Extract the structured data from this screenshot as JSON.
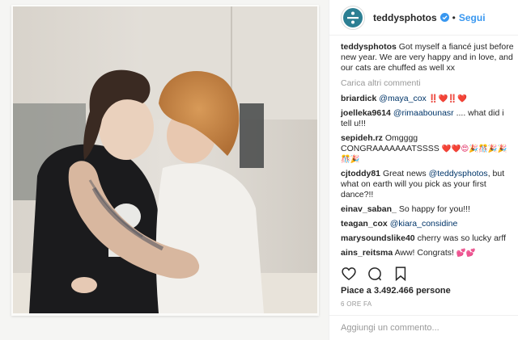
{
  "post": {
    "username": "teddysphotos",
    "separator": "•",
    "follow_label": "Segui",
    "caption_user": "teddysphotos",
    "caption_text": "Got myself a fiancé just before new year. We are very happy and in love, and our cats are chuffed as well xx",
    "load_more": "Carica altri commenti",
    "comments": [
      {
        "user": "briardick",
        "mention": "@maya_cox",
        "text": "",
        "emoji": "‼️❤️‼️❤️"
      },
      {
        "user": "joelleka9614",
        "mention": "@rimaabounasr",
        "text": ".... what did i tell u!!!",
        "emoji": ""
      },
      {
        "user": "sepideh.rz",
        "mention": "",
        "text": "Omgggg CONGRAAAAAAATSSSS",
        "emoji": "❤️❤️😍🎉🎊🎉🎉🎊🎉"
      },
      {
        "user": "cjtoddy81",
        "mention": "",
        "text": "Great news",
        "mention2": "@teddysphotos",
        "text2": ", but what on earth will you pick as your first dance?!!",
        "emoji": ""
      },
      {
        "user": "einav_saban_",
        "mention": "",
        "text": "So happy for you!!!",
        "emoji": ""
      },
      {
        "user": "teagan_cox",
        "mention": "@kiara_considine",
        "text": "",
        "emoji": ""
      },
      {
        "user": "marysoundslike40",
        "mention": "",
        "text": "cherry was so lucky arff",
        "emoji": ""
      },
      {
        "user": "ains_reitsma",
        "mention": "",
        "text": "Aww! Congrats!",
        "emoji": "💕💕"
      }
    ],
    "likes": "Piace a 3.492.466 persone",
    "timestamp": "6 ORE FA",
    "add_comment_placeholder": "Aggiungi un commento..."
  },
  "icons": {
    "avatar": "divide-logo-icon",
    "verified": "verified-badge-icon",
    "like": "heart-outline-icon",
    "comment": "speech-bubble-icon",
    "save": "bookmark-icon"
  },
  "colors": {
    "link_blue": "#3897f0",
    "mention_blue": "#003569",
    "avatar_teal": "#2c7f93",
    "muted": "#999999"
  }
}
